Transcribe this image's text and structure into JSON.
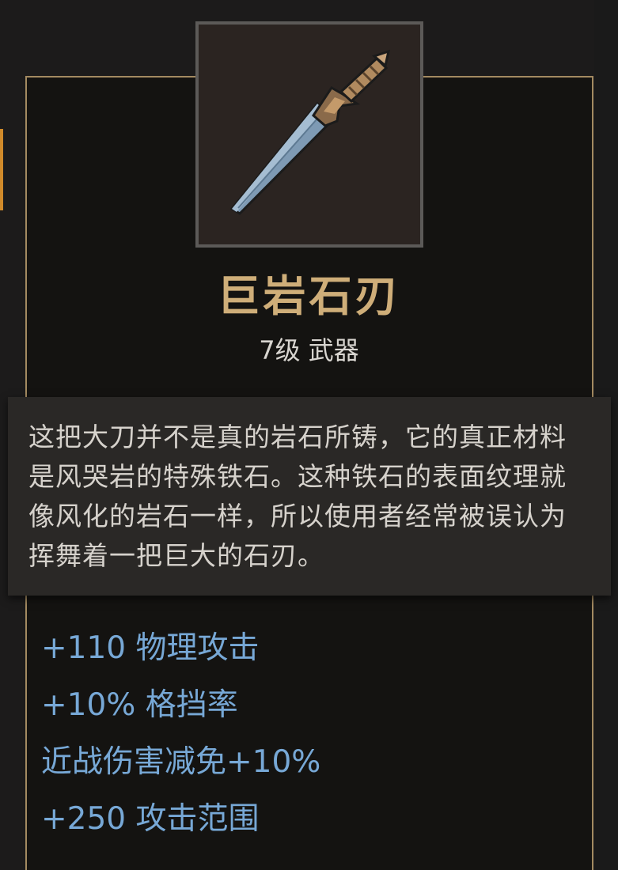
{
  "item": {
    "name": "巨岩石刃",
    "type": "7级 武器",
    "description": "这把大刀并不是真的岩石所铸，它的真正材料是风哭岩的特殊铁石。这种铁石的表面纹理就像风化的岩石一样，所以使用者经常被误认为挥舞着一把巨大的石刃。",
    "icon": "sword-icon"
  },
  "stats": [
    "+110 物理攻击",
    "+10% 格挡率",
    "近战伤害减免+10%",
    "+250 攻击范围"
  ],
  "colors": {
    "name": "#cfae79",
    "stat": "#77a8d6",
    "border": "#a38a61",
    "accent": "#d08a2a"
  }
}
